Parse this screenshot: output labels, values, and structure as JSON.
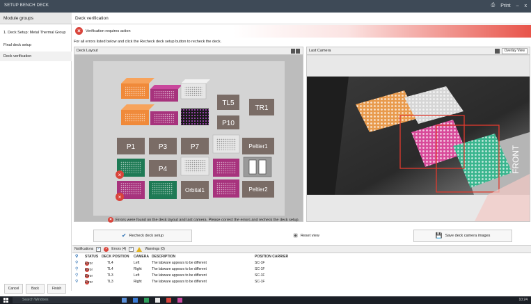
{
  "window": {
    "title": "SETUP BENCH DECK",
    "controls": [
      "Print",
      "–",
      "x"
    ],
    "print_icon": "printer-icon"
  },
  "sidebar": {
    "header": "Module groups",
    "items": [
      {
        "label": "1. Deck Setup: Metal Thermal Group",
        "active": false
      },
      {
        "label": "Final deck setup",
        "active": false
      },
      {
        "label": "Deck verification",
        "active": true
      }
    ],
    "buttons": [
      "Cancel",
      "Back",
      "Finish"
    ]
  },
  "main": {
    "header": "Deck verification",
    "alert": "Verification requires action",
    "instruction": "For all errors listed below and click the Recheck deck setup button to recheck the deck."
  },
  "deck": {
    "panel_title": "Deck Layout",
    "positions": [
      "TL5",
      "TR1",
      "P10",
      "P1",
      "P3",
      "P7",
      "Peltier1",
      "P4",
      "Orbital1",
      "Peltier2"
    ],
    "status": "Errors were found on the deck layout and last camera. Please correct the errors and recheck the deck setup."
  },
  "camera": {
    "panel_title": "Last Camera",
    "view_option": "Overlay View",
    "watermark": "FRONT"
  },
  "actions": {
    "recheck": "Recheck deck setup",
    "reset_view": "Reset view",
    "save_images": "Save deck camera images"
  },
  "results": {
    "header": "Notifications",
    "error_filter": "Errors (4)",
    "warning_filter": "Warnings (0)",
    "columns": [
      "STATUS",
      "DECK POSITION",
      "CAMERA",
      "DESCRIPTION",
      "POSITION CARRIER"
    ],
    "rows": [
      {
        "status": "Error",
        "position": "TL4",
        "camera": "Left",
        "description": "The labware appears to be different",
        "carrier": "SC-1F"
      },
      {
        "status": "Error",
        "position": "TL4",
        "camera": "Right",
        "description": "The labware appears to be different",
        "carrier": "SC-1F"
      },
      {
        "status": "Error",
        "position": "TL3",
        "camera": "Left",
        "description": "The labware appears to be different",
        "carrier": "SC-1F"
      },
      {
        "status": "Error",
        "position": "TL3",
        "camera": "Right",
        "description": "The labware appears to be different",
        "carrier": "SC-1F"
      }
    ]
  },
  "taskbar": {
    "search_placeholder": "Search Windows",
    "clock": "10:24"
  }
}
